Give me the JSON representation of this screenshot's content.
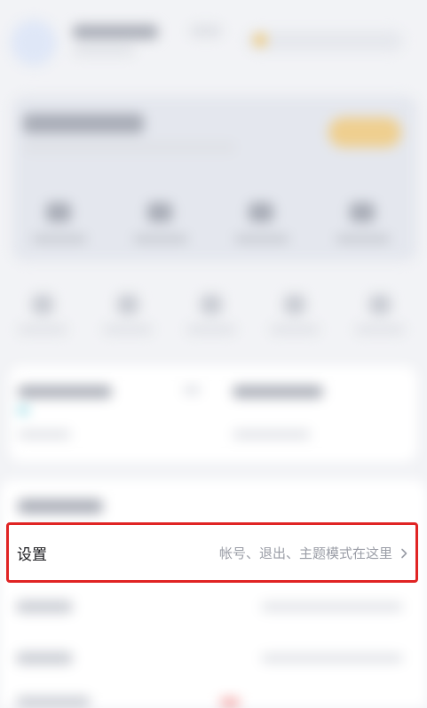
{
  "settings": {
    "title": "设置",
    "description": "帐号、退出、主题模式在这里"
  },
  "colors": {
    "highlight_border": "#e02424",
    "background": "#f2f3f6",
    "secondary_text": "#9a9da6"
  },
  "icons": {
    "settings_chevron": "chevron-right-icon"
  }
}
